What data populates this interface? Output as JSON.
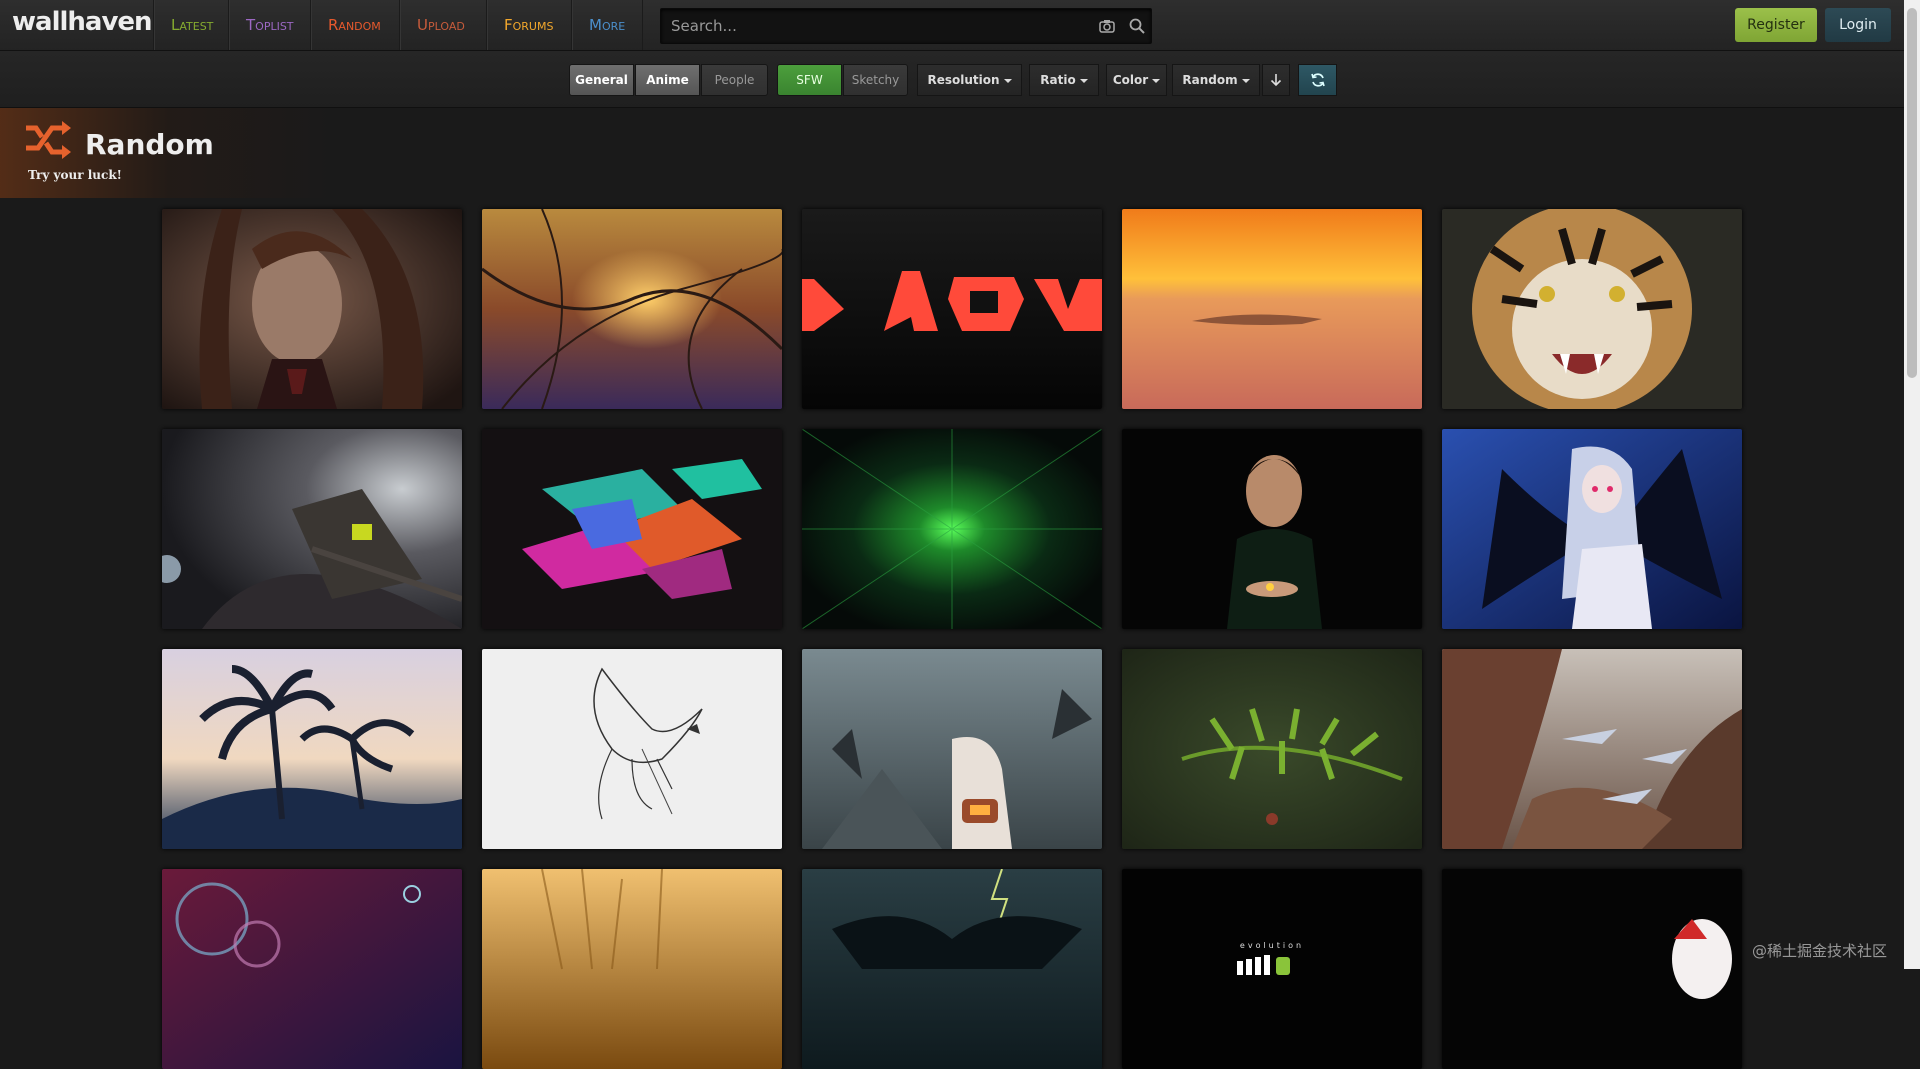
{
  "header": {
    "logo": "wallhaven",
    "nav": [
      {
        "label": "Latest",
        "color": "#85aa2f"
      },
      {
        "label": "Toplist",
        "color": "#9c68c3"
      },
      {
        "label": "Random",
        "color": "#e6592d"
      },
      {
        "label": "Upload",
        "color": "#c65b3b"
      },
      {
        "label": "Forums",
        "color": "#f3a82c"
      },
      {
        "label": "More",
        "color": "#4b8fcb"
      }
    ],
    "search_placeholder": "Search...",
    "register_label": "Register",
    "login_label": "Login"
  },
  "filters": {
    "categories": [
      "General",
      "Anime",
      "People"
    ],
    "purity": [
      "SFW",
      "Sketchy"
    ],
    "dropdowns": [
      "Resolution",
      "Ratio",
      "Color",
      "Random"
    ]
  },
  "page": {
    "title": "Random",
    "subtitle": "Try your luck!"
  },
  "thumbnails": [
    {
      "subject": "anime girl portrait"
    },
    {
      "subject": "branches at sunset"
    },
    {
      "subject": "red geometric letters"
    },
    {
      "subject": "orange sunset over sea"
    },
    {
      "subject": "roaring tiger"
    },
    {
      "subject": "space station"
    },
    {
      "subject": "colorful abstract shards"
    },
    {
      "subject": "green starburst"
    },
    {
      "subject": "man in dark holding ring"
    },
    {
      "subject": "anime girl with black wings"
    },
    {
      "subject": "palm trees silhouette"
    },
    {
      "subject": "eagle sketch"
    },
    {
      "subject": "fantasy battle scene"
    },
    {
      "subject": "green fern leaves"
    },
    {
      "subject": "canyon with jets"
    },
    {
      "subject": "bubbles on purple"
    },
    {
      "subject": "golden wheat"
    },
    {
      "subject": "dragon in storm"
    },
    {
      "subject": "evolution android"
    },
    {
      "subject": "anime character in dark"
    }
  ],
  "evolution_text": "evolution",
  "watermark": "@稀土掘金技术社区"
}
